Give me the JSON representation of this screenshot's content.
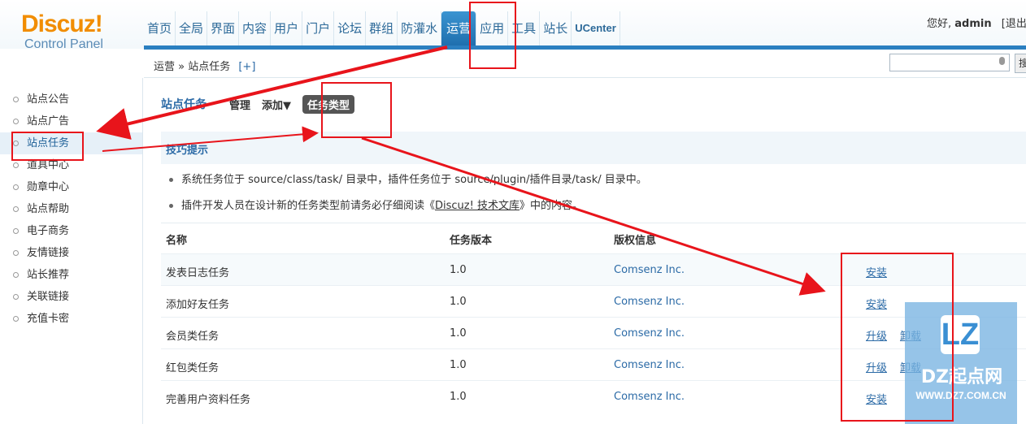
{
  "header": {
    "logo_text": "Discuz!",
    "logo_sub": "Control Panel",
    "nav": [
      "首页",
      "全局",
      "界面",
      "内容",
      "用户",
      "门户",
      "论坛",
      "群组",
      "防灌水",
      "运营",
      "应用",
      "工具",
      "站长",
      "UCenter"
    ],
    "active_nav": "运营",
    "greeting": "您好,",
    "username": "admin",
    "logout": "[退出"
  },
  "breadcrumb": {
    "text": "运营 » 站点任务",
    "add": "[+]"
  },
  "search": {
    "button": "搜"
  },
  "sidebar": {
    "items": [
      "站点公告",
      "站点广告",
      "站点任务",
      "道具中心",
      "勋章中心",
      "站点帮助",
      "电子商务",
      "友情链接",
      "站长推荐",
      "关联链接",
      "充值卡密"
    ],
    "active": "站点任务"
  },
  "subnav": {
    "title": "站点任务",
    "tabs": [
      "管理",
      "添加▼",
      "任务类型"
    ],
    "active_tab": "任务类型"
  },
  "tips": {
    "title": "技巧提示",
    "line1": "系统任务位于 source/class/task/ 目录中，插件任务位于 source/plugin/插件目录/task/ 目录中。",
    "line2_pre": "插件开发人员在设计新的任务类型前请务必仔细阅读《",
    "line2_link": "Discuz! 技术文库",
    "line2_post": "》中的内容。"
  },
  "table": {
    "headers": [
      "名称",
      "任务版本",
      "版权信息"
    ],
    "rows": [
      {
        "name": "发表日志任务",
        "version": "1.0",
        "copyright": "Comsenz Inc.",
        "actions": [
          "安装"
        ]
      },
      {
        "name": "添加好友任务",
        "version": "1.0",
        "copyright": "Comsenz Inc.",
        "actions": [
          "安装"
        ]
      },
      {
        "name": "会员类任务",
        "version": "1.0",
        "copyright": "Comsenz Inc.",
        "actions": [
          "升级",
          "卸载"
        ]
      },
      {
        "name": "红包类任务",
        "version": "1.0",
        "copyright": "Comsenz Inc.",
        "actions": [
          "升级",
          "卸载"
        ]
      },
      {
        "name": "完善用户资料任务",
        "version": "1.0",
        "copyright": "Comsenz Inc.",
        "actions": [
          "安装"
        ]
      }
    ]
  },
  "watermark": {
    "logo": "LZ",
    "name": "DZ起点网",
    "url": "WWW.DZ7.COM.CN"
  },
  "annotation_color": "#e8141b"
}
